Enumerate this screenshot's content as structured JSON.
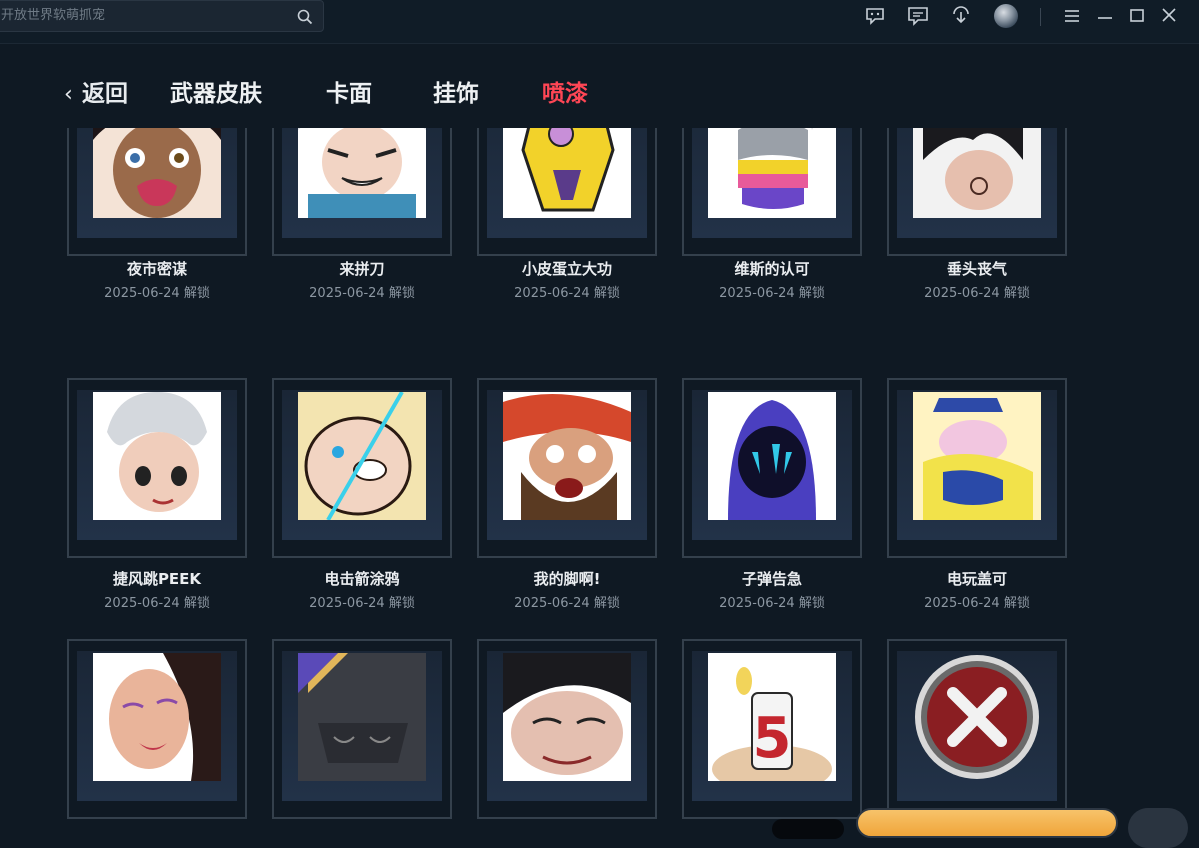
{
  "search": {
    "placeholder": "开放世界软萌抓宠"
  },
  "toolbar": {
    "icons": [
      "chat-bubble-icon",
      "message-icon",
      "download-icon",
      "avatar",
      "menu-icon",
      "minimize-icon",
      "maximize-icon",
      "close-icon"
    ]
  },
  "nav": {
    "back_label": "返回",
    "tabs": [
      {
        "label": "武器皮肤",
        "active": false
      },
      {
        "label": "卡面",
        "active": false
      },
      {
        "label": "挂饰",
        "active": false
      },
      {
        "label": "喷漆",
        "active": true
      }
    ],
    "active_color": "#ff4655"
  },
  "sprays": [
    {
      "name": "夜市密谋",
      "date": "2025-06-24 解锁"
    },
    {
      "name": "来拼刀",
      "date": "2025-06-24 解锁"
    },
    {
      "name": "小皮蛋立大功",
      "date": "2025-06-24 解锁"
    },
    {
      "name": "维斯的认可",
      "date": "2025-06-24 解锁"
    },
    {
      "name": "垂头丧气",
      "date": "2025-06-24 解锁"
    },
    {
      "name": "捷风跳PEEK",
      "date": "2025-06-24 解锁"
    },
    {
      "name": "电击箭涂鸦",
      "date": "2025-06-24 解锁"
    },
    {
      "name": "我的脚啊!",
      "date": "2025-06-24 解锁"
    },
    {
      "name": "子弹告急",
      "date": "2025-06-24 解锁"
    },
    {
      "name": "电玩盖可",
      "date": "2025-06-24 解锁"
    },
    {
      "name": "",
      "date": ""
    },
    {
      "name": "",
      "date": ""
    },
    {
      "name": "",
      "date": ""
    },
    {
      "name": "",
      "date": ""
    },
    {
      "name": "",
      "date": ""
    }
  ]
}
